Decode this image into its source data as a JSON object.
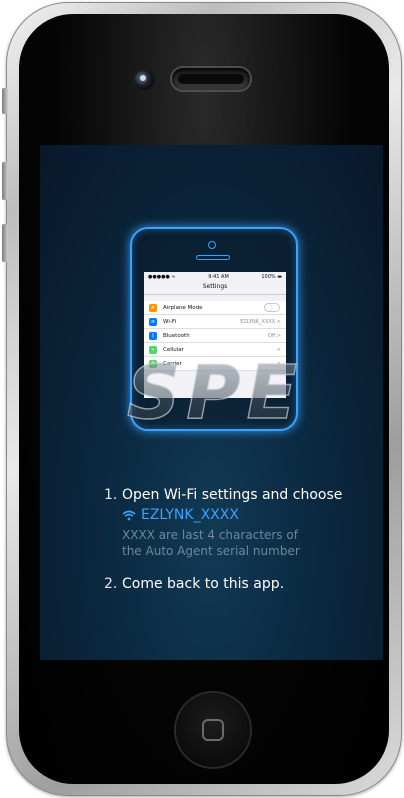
{
  "device": {
    "home_button_icon": "home-square-icon"
  },
  "mini_phone": {
    "status_bar": {
      "carrier": "●●●●● ≈",
      "time": "9:41 AM",
      "battery": "100% ▬"
    },
    "title": "Settings",
    "rows": [
      {
        "label": "Airplane Mode",
        "value": "",
        "icon_color": "#ff9500",
        "icon": "airplane-icon"
      },
      {
        "label": "Wi-Fi",
        "value": "EZLYNK_XXXX >",
        "icon_color": "#007aff",
        "icon": "wifi-icon"
      },
      {
        "label": "Bluetooth",
        "value": "Off >",
        "icon_color": "#007aff",
        "icon": "bluetooth-icon"
      },
      {
        "label": "Cellular",
        "value": ">",
        "icon_color": "#4cd964",
        "icon": "cellular-icon"
      },
      {
        "label": "Carrier",
        "value": ">",
        "icon_color": "#4cd964",
        "icon": "phone-icon"
      }
    ]
  },
  "logo": {
    "text": "SPE"
  },
  "instructions": {
    "step1_number": "1.",
    "step1_text": "Open Wi-Fi settings and choose",
    "wifi_icon": "wifi-icon",
    "wifi_name": "EZLYNK_XXXX",
    "hint_line1": "XXXX are last 4 characters of",
    "hint_line2": "the Auto Agent serial number",
    "step2_number": "2.",
    "step2_text": "Come back to this app."
  },
  "colors": {
    "accent": "#3aa2ff",
    "screen_bg": "#0b2a42"
  }
}
